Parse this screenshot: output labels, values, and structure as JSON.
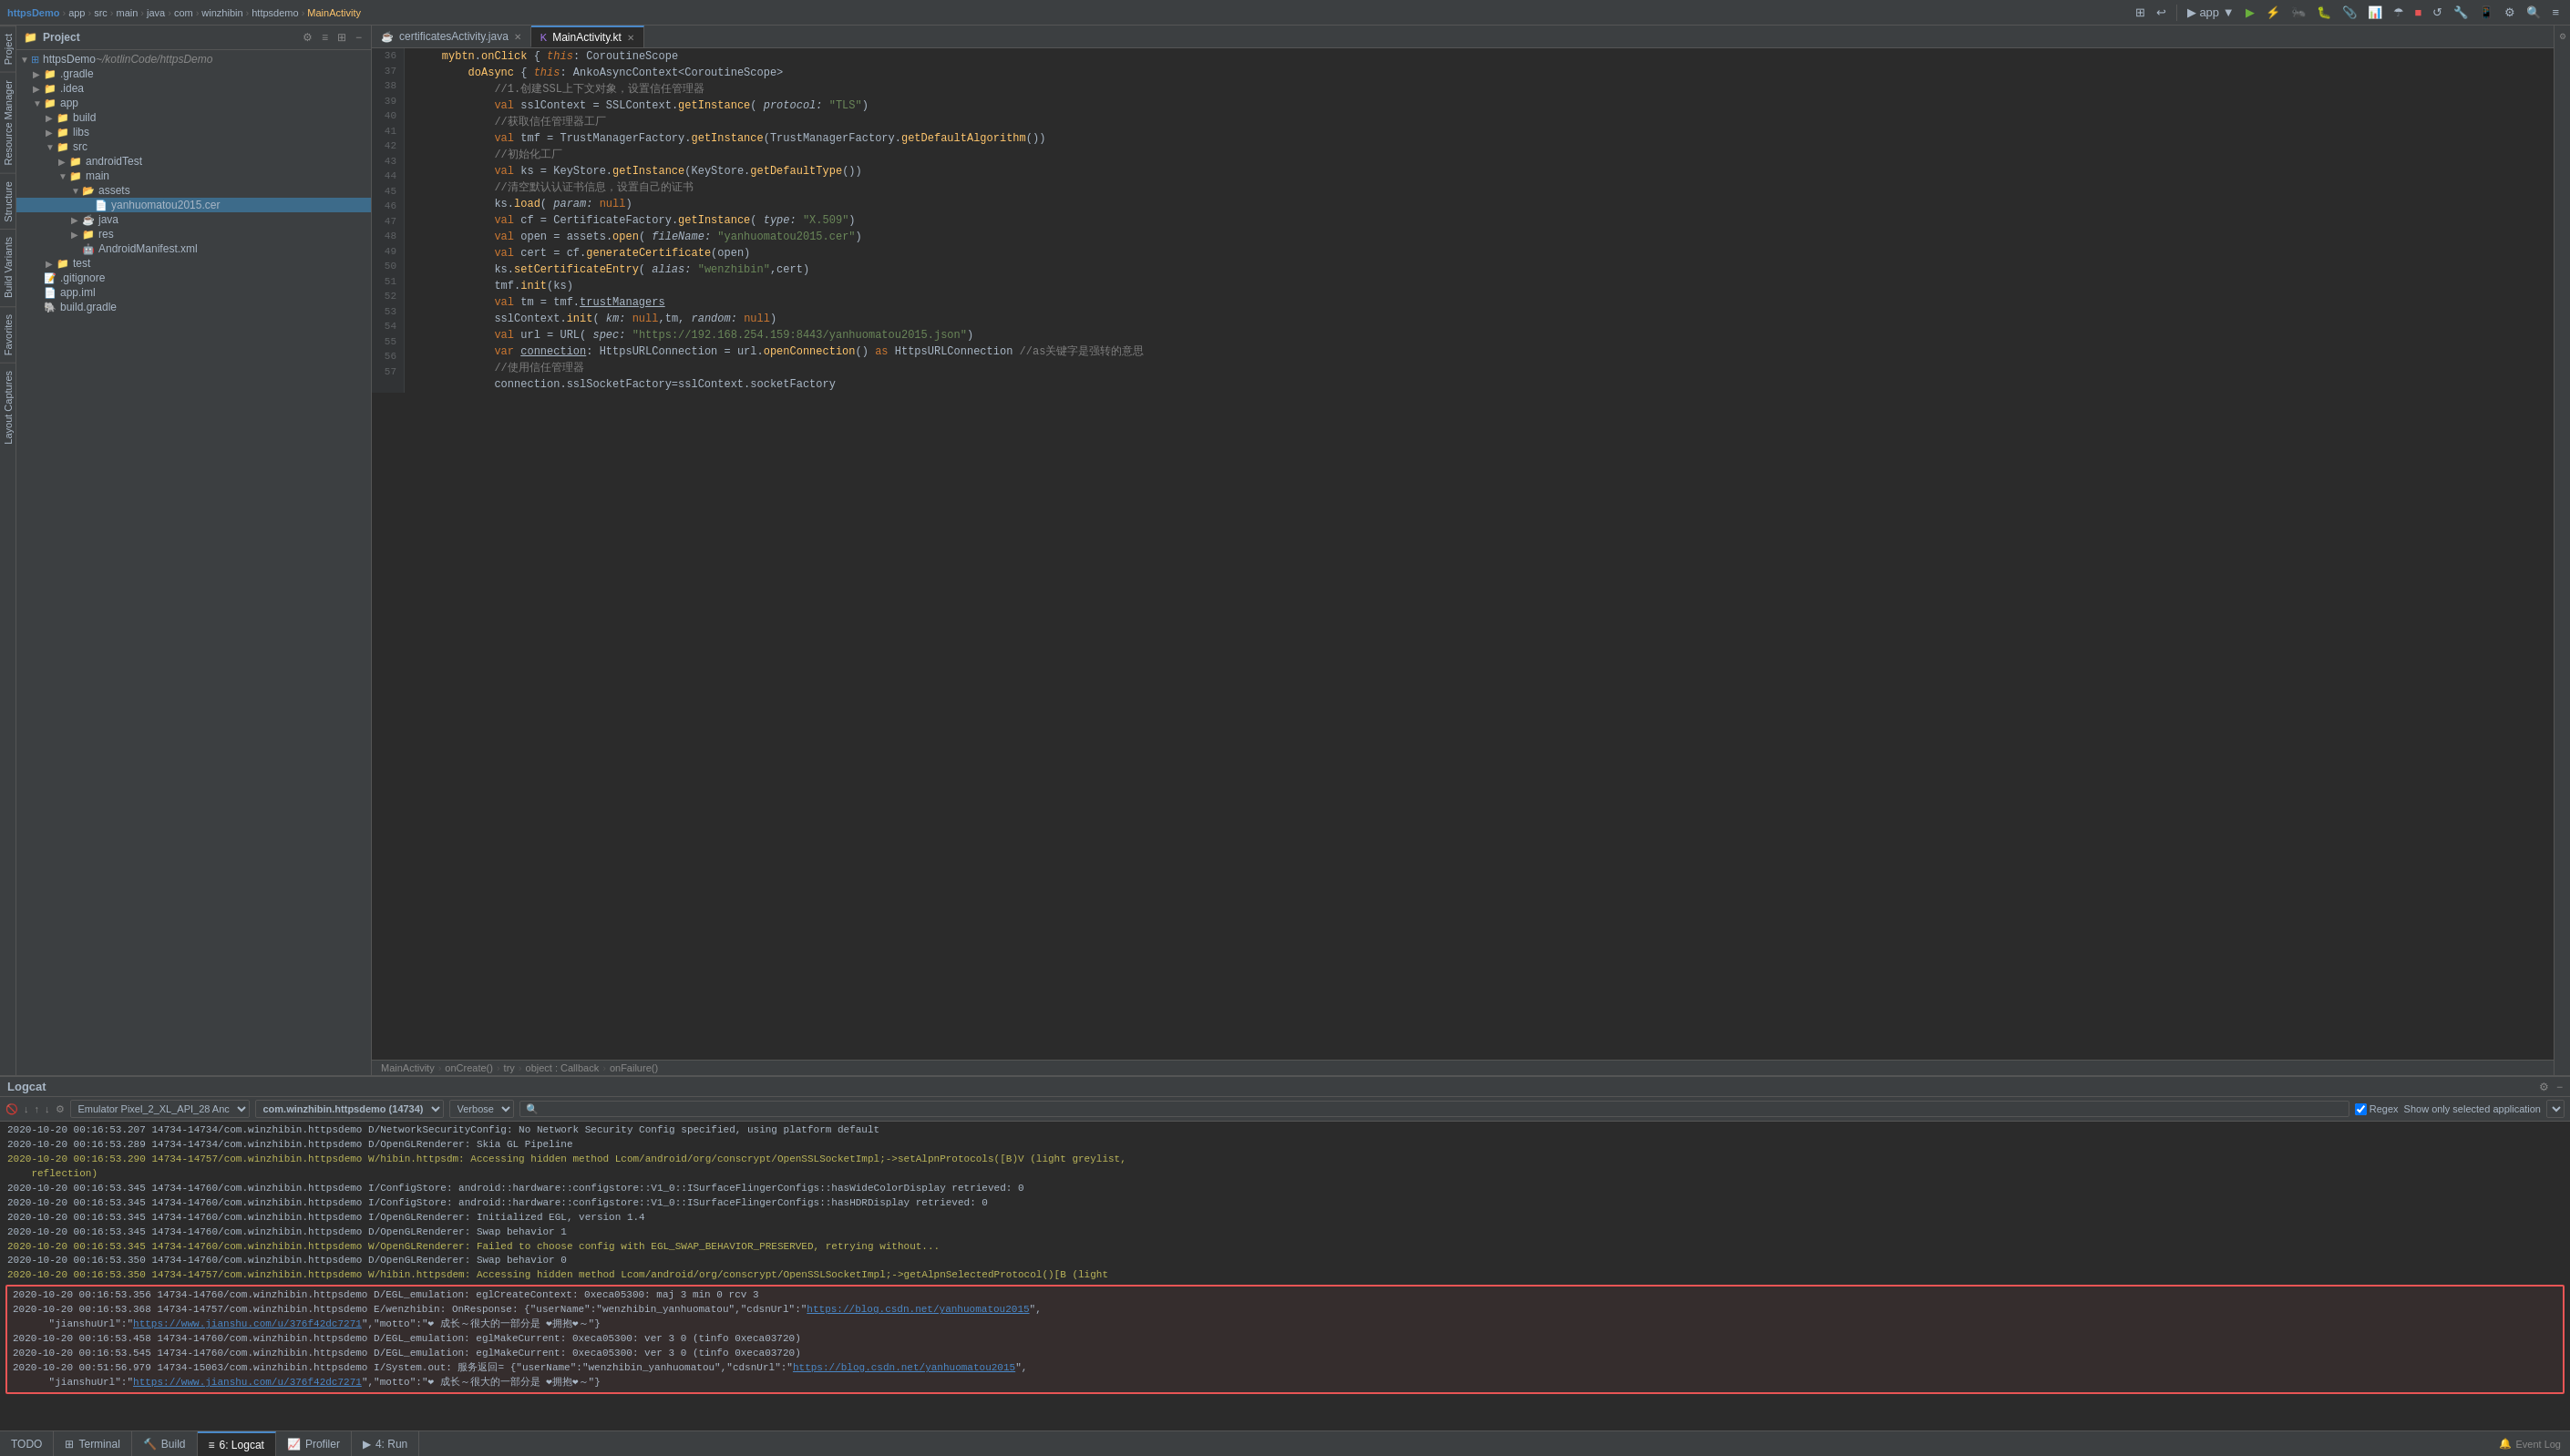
{
  "topbar": {
    "breadcrumb": [
      "httpsDemo",
      "app",
      "src",
      "main",
      "java",
      "com",
      "winzhibin",
      "httpsdemo",
      "MainActivity"
    ],
    "separator": "›"
  },
  "project": {
    "title": "Project",
    "items": [
      {
        "id": "httpsdemo",
        "label": "httpsDemo",
        "suffix": " ~/kotlinCode/httpsDemo",
        "level": 0,
        "type": "project",
        "expanded": true
      },
      {
        "id": "gradle",
        "label": ".gradle",
        "level": 1,
        "type": "folder",
        "expanded": false
      },
      {
        "id": "idea",
        "label": ".idea",
        "level": 1,
        "type": "folder",
        "expanded": false
      },
      {
        "id": "app",
        "label": "app",
        "level": 1,
        "type": "folder",
        "expanded": true
      },
      {
        "id": "build",
        "label": "build",
        "level": 2,
        "type": "folder",
        "expanded": false
      },
      {
        "id": "libs",
        "label": "libs",
        "level": 2,
        "type": "folder",
        "expanded": false
      },
      {
        "id": "src",
        "label": "src",
        "level": 2,
        "type": "folder",
        "expanded": true
      },
      {
        "id": "androidtest",
        "label": "androidTest",
        "level": 3,
        "type": "folder",
        "expanded": false
      },
      {
        "id": "main",
        "label": "main",
        "level": 3,
        "type": "folder",
        "expanded": true
      },
      {
        "id": "assets",
        "label": "assets",
        "level": 4,
        "type": "folder",
        "expanded": true
      },
      {
        "id": "yanhua",
        "label": "yanhuomatou2015.cer",
        "level": 5,
        "type": "cer"
      },
      {
        "id": "java",
        "label": "java",
        "level": 4,
        "type": "folder",
        "expanded": false
      },
      {
        "id": "res",
        "label": "res",
        "level": 4,
        "type": "folder",
        "expanded": false
      },
      {
        "id": "manifest",
        "label": "AndroidManifest.xml",
        "level": 4,
        "type": "xml"
      },
      {
        "id": "test",
        "label": "test",
        "level": 2,
        "type": "folder",
        "expanded": false
      },
      {
        "id": "gitignore",
        "label": ".gitignore",
        "level": 1,
        "type": "file"
      },
      {
        "id": "appiml",
        "label": "app.iml",
        "level": 1,
        "type": "file"
      },
      {
        "id": "buildgradle",
        "label": "build.gradle",
        "level": 1,
        "type": "gradle"
      }
    ]
  },
  "tabs": [
    {
      "id": "cert",
      "label": "certificatesActivity.java",
      "type": "java",
      "active": false
    },
    {
      "id": "main",
      "label": "MainActivity.kt",
      "type": "kt",
      "active": true
    }
  ],
  "code": {
    "lines": [
      {
        "num": 36,
        "content": "",
        "tokens": []
      },
      {
        "num": 37,
        "content": "    mybtn.onClick { this: CoroutineScope"
      },
      {
        "num": 38,
        "content": "        doAsync { this: AnkoAsyncContext<CoroutineScope>"
      },
      {
        "num": 39,
        "content": "            //1.创建SSL上下文对象，设置信任管理器"
      },
      {
        "num": 40,
        "content": "            val sslContext = SSLContext.getInstance( protocol: \"TLS\")"
      },
      {
        "num": 41,
        "content": "            //获取信任管理器工厂"
      },
      {
        "num": 42,
        "content": "            val tmf = TrustManagerFactory.getInstance(TrustManagerFactory.getDefaultAlgorithm())"
      },
      {
        "num": 43,
        "content": "            //初始化工厂"
      },
      {
        "num": 44,
        "content": "            val ks = KeyStore.getInstance(KeyStore.getDefaultType())"
      },
      {
        "num": 45,
        "content": "            //清空默认认证书信息，设置自己的证书"
      },
      {
        "num": 46,
        "content": "            ks.load( param: null)"
      },
      {
        "num": 47,
        "content": "            val cf = CertificateFactory.getInstance( type: \"X.509\")"
      },
      {
        "num": 48,
        "content": "            val open = assets.open( fileName: \"yanhuomatou2015.cer\")"
      },
      {
        "num": 49,
        "content": "            val cert = cf.generateCertificate(open)"
      },
      {
        "num": 50,
        "content": "            ks.setCertificateEntry( alias: \"wenzhibin\",cert)"
      },
      {
        "num": 51,
        "content": "            tmf.init(ks)"
      },
      {
        "num": 52,
        "content": "            val tm = tmf.trustManagers"
      },
      {
        "num": 53,
        "content": "            sslContext.init( km: null,tm, random: null)"
      },
      {
        "num": 54,
        "content": "            val url = URL( spec: \"https://192.168.254.159:8443/yanhuomatou2015.json\")"
      },
      {
        "num": 55,
        "content": "            var connection: HttpsURLConnection = url.openConnection() as HttpsURLConnection //as关键字是强转的意思"
      },
      {
        "num": 56,
        "content": "            //使用信任管理器"
      },
      {
        "num": 57,
        "content": "            connection.sslSocketFactory=sslContext.socketFactory"
      }
    ]
  },
  "breadcrumb_bottom": {
    "items": [
      "MainActivity",
      "onCreate()",
      "try",
      "object : Callback",
      "onFailure()"
    ]
  },
  "logcat": {
    "title": "Logcat",
    "device": "Emulator Pixel_2_XL_API_28 Anc ▼",
    "app": "com.winzhibin.httpsdemo (14734) ▼",
    "level": "Verbose ▼",
    "search_placeholder": "🔍",
    "regex_label": "Regex",
    "regex_checked": true,
    "show_only_label": "Show only selected application",
    "logs": [
      {
        "level": "debug",
        "text": "2020-10-20 00:16:53.207 14734-14734/com.winzhibin.httpsdemo D/NetworkSecurityConfig: No Network Security Config specified, using platform default"
      },
      {
        "level": "debug",
        "text": "2020-10-20 00:16:53.289 14734-14734/com.winzhibin.httpsdemo D/OpenGLRenderer: Skia GL Pipeline"
      },
      {
        "level": "warning",
        "text": "2020-10-20 00:16:53.290 14734-14757/com.winzhibin.httpsdemo W/hibin.httpsdm: Accessing hidden method Lcom/android/org/conscrypt/OpenSSLSocketImpl;->setAlpnProtocols([B)V (light greylist, reflection)"
      },
      {
        "level": "debug",
        "text": "2020-10-20 00:16:53.345 14734-14760/com.winzhibin.httpsdemo I/ConfigStore: android::hardware::configstore::V1_0::ISurfaceFlingerConfigs::hasWideColorDisplay retrieved: 0"
      },
      {
        "level": "debug",
        "text": "2020-10-20 00:16:53.345 14734-14760/com.winzhibin.httpsdemo I/ConfigStore: android::hardware::configstore::V1_0::ISurfaceFlingerConfigs::hasHDRDisplay retrieved: 0"
      },
      {
        "level": "debug",
        "text": "2020-10-20 00:16:53.345 14734-14760/com.winzhibin.httpsdemo I/OpenGLRenderer: Initialized EGL, version 1.4"
      },
      {
        "level": "debug",
        "text": "2020-10-20 00:16:53.345 14734-14760/com.winzhibin.httpsdemo D/OpenGLRenderer: Swap behavior 1"
      },
      {
        "level": "warning",
        "text": "2020-10-20 00:16:53.345 14734-14760/com.winzhibin.httpsdemo W/OpenGLRenderer: Failed to choose config with EGL_SWAP_BEHAVIOR_PRESERVED, retrying without..."
      },
      {
        "level": "debug",
        "text": "2020-10-20 00:16:53.350 14734-14760/com.winzhibin.httpsdemo D/OpenGLRenderer: Swap behavior 0"
      },
      {
        "level": "warning",
        "text": "2020-10-20 00:16:53.350 14734-14757/com.winzhibin.httpsdemo W/hibin.httpsdem: Accessing hidden method Lcom/android/org/conscrypt/OpenSSLSocketImpl;->getAlpnSelectedProtocol()[B (light"
      },
      {
        "level": "highlight",
        "text": "2020-10-20 00:16:53.356 14734-14760/com.winzhibin.httpsdemo D/EGL_emulation: eglCreateContext: 0xeca05300: maj 3 min 0 rcv 3"
      },
      {
        "level": "highlight",
        "text": "2020-10-20 00:16:53.368 14734-14757/com.winzhibin.httpsdemo E/wenzhibin: OnResponse: {\"userName\":\"wenzhibin_yanhuomatou\",\"cdsnUrl\":\"https://blog.csdn.net/yanhuomatou2015\", \"jianshuUrl\":\"https://www.jianshu.com/u/376f42dc7271\",\"motto\":\"❤ 成长～很大的一部分是 ❤拥抱❤～\"}"
      },
      {
        "level": "highlight",
        "text": "2020-10-20 00:16:53.458 14734-14760/com.winzhibin.httpsdemo D/EGL_emulation: eglMakeCurrent: 0xeca05300: ver 3 0 (tinfo 0xeca03720)"
      },
      {
        "level": "highlight",
        "text": "2020-10-20 00:16:53.545 14734-14760/com.winzhibin.httpsdemo D/EGL_emulation: eglMakeCurrent: 0xeca05300: ver 3 0 (tinfo 0xeca03720)"
      },
      {
        "level": "highlight",
        "text": "2020-10-20 00:51:56.979 14734-15063/com.winzhibin.httpsdemo I/System.out: 服务返回= {\"userName\":\"wenzhibin_yanhuomatou\",\"cdsnUrl\":\"https://blog.csdn.net/yanhuomatou2015\", \"jianshuUrl\":\"https://www.jianshu.com/u/376f42dc7271\",\"motto\":\"❤ 成长～很大的一部分是 ❤拥抱❤～\"}"
      }
    ]
  },
  "statusbar": {
    "tabs": [
      {
        "id": "todo",
        "label": "TODO",
        "active": false
      },
      {
        "id": "terminal",
        "label": "Terminal",
        "active": false
      },
      {
        "id": "build",
        "label": "Build",
        "active": false
      },
      {
        "id": "logcat",
        "label": "6: Logcat",
        "active": true
      },
      {
        "id": "profiler",
        "label": "Profiler",
        "active": false
      },
      {
        "id": "run",
        "label": "4: Run",
        "active": false
      }
    ],
    "event_log": "Event Log"
  }
}
